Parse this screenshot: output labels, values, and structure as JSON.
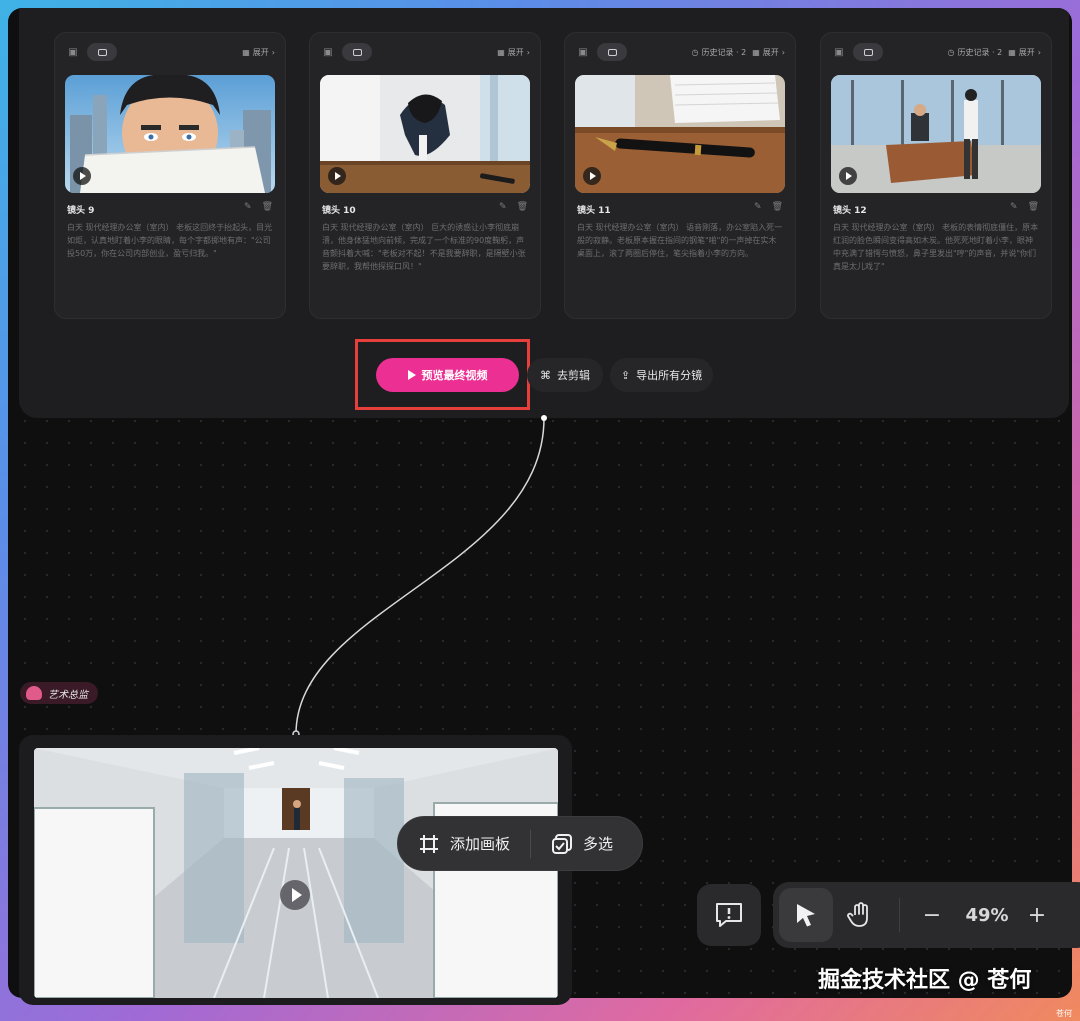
{
  "shots": [
    {
      "title": "镜头 9",
      "history": "",
      "expand": "展开",
      "desc": "白天 现代经理办公室（室内） 老板这回终于抬起头，目光如炬，认真地盯着小李的眼睛，每个字都掷地有声：\"公司投50万，你在公司内部创业，盈亏归我。\""
    },
    {
      "title": "镜头 10",
      "history": "",
      "expand": "展开",
      "desc": "白天 现代经理办公室（室内） 巨大的诱惑让小李彻底崩溃，他身体猛地向前倾，完成了一个标准的90度鞠躬，声音颤抖着大喊：\"老板对不起！不是我要辞职，是隔壁小张要辞职，我帮他探探口风！\""
    },
    {
      "title": "镜头 11",
      "history": "历史记录 · 2",
      "expand": "展开",
      "desc": "白天 现代经理办公室（室内） 语音刚落，办公室陷入死一般的寂静。老板原本握在指间的钢笔\"啪\"的一声掉在实木桌面上，滚了两圈后停住，笔尖指着小李的方向。"
    },
    {
      "title": "镜头 12",
      "history": "历史记录 · 2",
      "expand": "展开",
      "desc": "白天 现代经理办公室（室内） 老板的表情彻底僵住，原本红润的脸色瞬间变得高如木炭。他死死地盯着小李，眼神中充满了错愕与愤怒，鼻子里发出\"哼\"的声音，并说\"你们真是太儿戏了\""
    }
  ],
  "actions": {
    "preview": "预览最终视频",
    "edit": "去剪辑",
    "export": "导出所有分镜"
  },
  "tag": {
    "label": "艺术总监"
  },
  "floatbar": {
    "add": "添加画板",
    "multi": "多选"
  },
  "zoom": {
    "minus": "−",
    "value": "49%",
    "plus": "+"
  },
  "watermark": "掘金技术社区 @ 苍何",
  "corner": "苍何",
  "colors": {
    "accent": "#ec2f92",
    "highlight": "#e7403c"
  },
  "icons": {
    "feedback": "feedback-icon",
    "select": "cursor-arrow-icon",
    "hand": "hand-pan-icon"
  }
}
